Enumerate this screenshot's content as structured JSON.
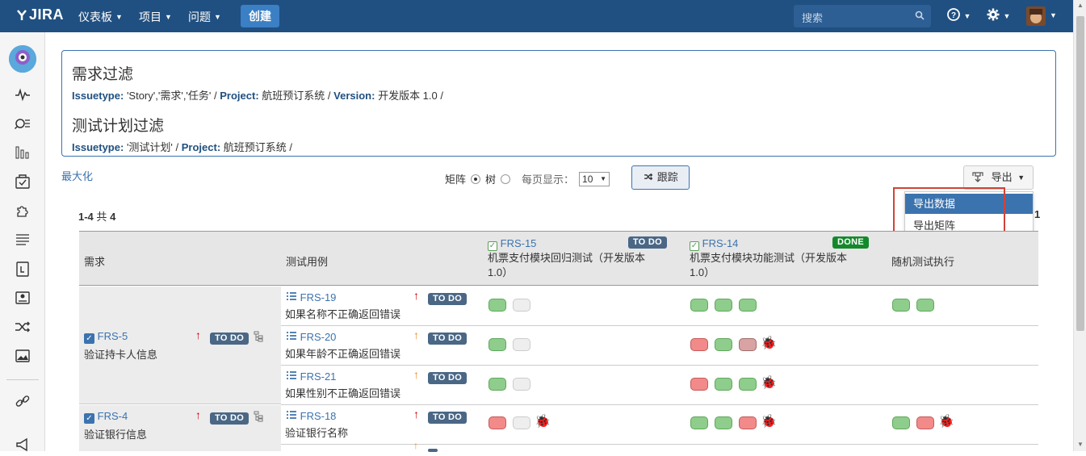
{
  "header": {
    "logo": "JIRA",
    "nav": [
      "仪表板",
      "项目",
      "问题"
    ],
    "create": "创建",
    "search_placeholder": "搜索"
  },
  "filters": {
    "req_title": "需求过滤",
    "req_line": [
      {
        "label": "Issuetype:",
        "value": "'Story','需求','任务' /"
      },
      {
        "label": "Project:",
        "value": "航班预订系统 /"
      },
      {
        "label": "Version:",
        "value": "开发版本 1.0 /"
      }
    ],
    "plan_title": "测试计划过滤",
    "plan_line": [
      {
        "label": "Issuetype:",
        "value": "'测试计划' /"
      },
      {
        "label": "Project:",
        "value": "航班预订系统 /"
      }
    ]
  },
  "toolbar": {
    "maximize": "最大化",
    "matrix": "矩阵",
    "tree": "树",
    "per_page": "每页显示：",
    "per_page_value": "10",
    "track": "跟踪",
    "export": "导出",
    "export_menu": [
      "导出数据",
      "导出矩阵"
    ]
  },
  "count": {
    "range": "1-4",
    "of": "共",
    "total": "4",
    "page": "1"
  },
  "table": {
    "col_req": "需求",
    "col_tc": "测试用例",
    "plans": [
      {
        "key": "FRS-15",
        "status": "TO DO",
        "summary_l1": "机票支付模块回归测试（开发版本",
        "summary_l2": "1.0）"
      },
      {
        "key": "FRS-14",
        "status": "DONE",
        "summary_l1": "机票支付模块功能测试（开发版本",
        "summary_l2": "1.0）"
      }
    ],
    "col_random": "随机测试执行",
    "requirements": [
      {
        "key": "FRS-5",
        "status": "TO DO",
        "summary": "验证持卡人信息"
      },
      {
        "key": "FRS-4",
        "status": "TO DO",
        "summary": "验证银行信息"
      }
    ],
    "testcases": [
      {
        "key": "FRS-19",
        "status": "TO DO",
        "summary": "如果名称不正确返回错误"
      },
      {
        "key": "FRS-20",
        "status": "TO DO",
        "summary": "如果年龄不正确返回错误"
      },
      {
        "key": "FRS-21",
        "status": "TO DO",
        "summary": "如果性别不正确返回错误"
      },
      {
        "key": "FRS-18",
        "status": "TO DO",
        "summary": "验证银行名称"
      }
    ]
  },
  "colors": {
    "header": "#205081",
    "link": "#3b73af",
    "pass": "#8fcd8c",
    "fail": "#f28a8a",
    "highlight_border": "#d04437"
  }
}
